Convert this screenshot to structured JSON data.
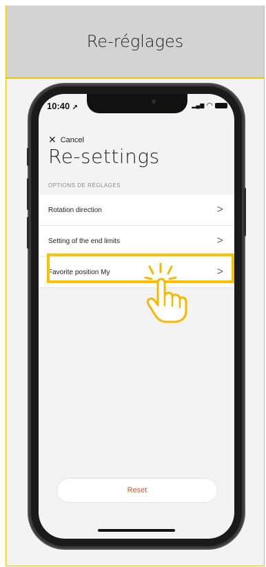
{
  "header": {
    "title": "Re-réglages"
  },
  "status_bar": {
    "time": "10:40"
  },
  "screen": {
    "cancel_label": "Cancel",
    "title": "Re-settings",
    "section_label": "OPTIONS DE RÉGLAGES",
    "items": [
      {
        "label": "Rotation direction"
      },
      {
        "label": "Setting of the end limits"
      },
      {
        "label": "Favorite position My"
      }
    ],
    "reset_label": "Reset"
  },
  "colors": {
    "accent_yellow": "#f7c200",
    "reset_orange": "#e0561a",
    "header_gray": "#d3d3d3"
  },
  "icons": [
    "location-arrow-icon",
    "signal-icon",
    "wifi-icon",
    "battery-icon",
    "close-icon",
    "chevron-right-icon",
    "tap-hand-icon"
  ]
}
